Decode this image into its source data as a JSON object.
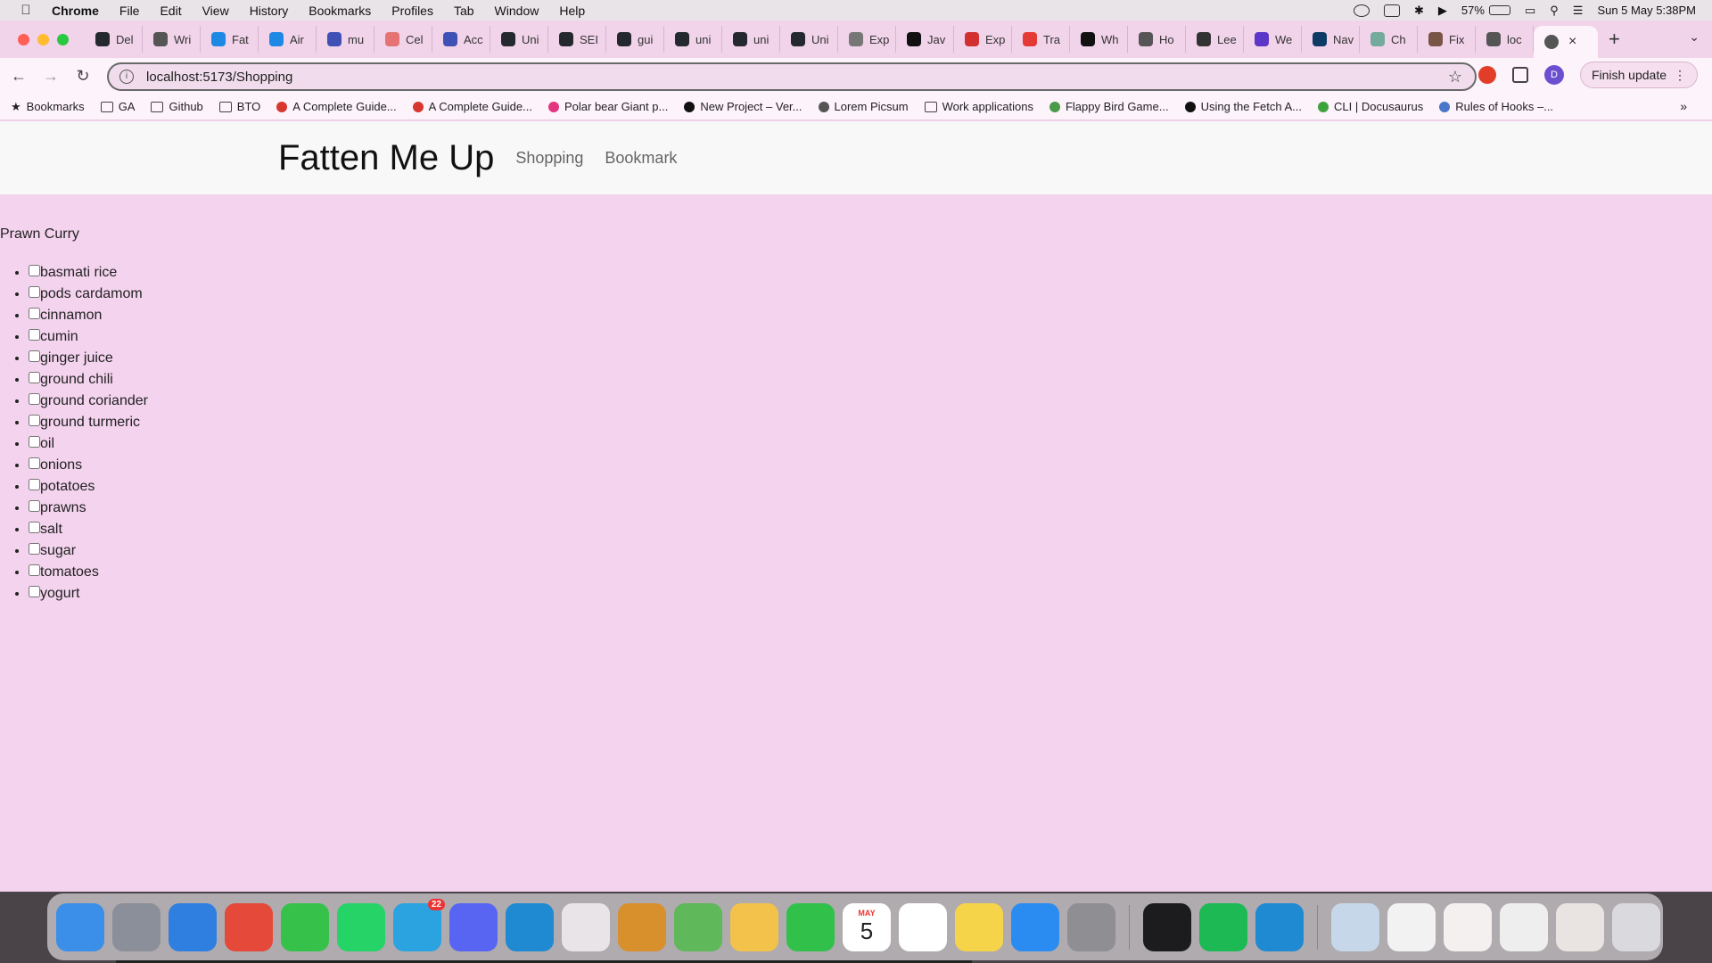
{
  "menubar": {
    "app": "Chrome",
    "items": [
      "File",
      "Edit",
      "View",
      "History",
      "Bookmarks",
      "Profiles",
      "Tab",
      "Window",
      "Help"
    ],
    "battery": "57%",
    "datetime": "Sun 5 May  5:38PM"
  },
  "tabs": [
    {
      "label": "Del",
      "color": "#24292f"
    },
    {
      "label": "Wri",
      "color": "#555555"
    },
    {
      "label": "Fat",
      "color": "#1e88e5"
    },
    {
      "label": "Air",
      "color": "#1e88e5"
    },
    {
      "label": "mu",
      "color": "#3f51b5"
    },
    {
      "label": "Cel",
      "color": "#e57373"
    },
    {
      "label": "Acc",
      "color": "#3f51b5"
    },
    {
      "label": "Uni",
      "color": "#24292f"
    },
    {
      "label": "SEI",
      "color": "#24292f"
    },
    {
      "label": "gui",
      "color": "#24292f"
    },
    {
      "label": "uni",
      "color": "#24292f"
    },
    {
      "label": "uni",
      "color": "#24292f"
    },
    {
      "label": "Uni",
      "color": "#24292f"
    },
    {
      "label": "Exp",
      "color": "#777777"
    },
    {
      "label": "Jav",
      "color": "#111111"
    },
    {
      "label": "Exp",
      "color": "#d32f2f"
    },
    {
      "label": "Tra",
      "color": "#e53935"
    },
    {
      "label": "Wh",
      "color": "#111111"
    },
    {
      "label": "Ho",
      "color": "#555555"
    },
    {
      "label": "Lee",
      "color": "#333333"
    },
    {
      "label": "We",
      "color": "#5c35c9"
    },
    {
      "label": "Nav",
      "color": "#0d3b66"
    },
    {
      "label": "Ch",
      "color": "#74aa9c"
    },
    {
      "label": "Fix",
      "color": "#795548"
    },
    {
      "label": "loc",
      "color": "#555555"
    }
  ],
  "active_tab": {
    "label": "",
    "color": "#555555"
  },
  "address": {
    "url": "localhost:5173/Shopping"
  },
  "toolbar": {
    "profile_initial": "D",
    "finish_update": "Finish update"
  },
  "bookmarks": [
    {
      "label": "Bookmarks",
      "icon": "star-icon"
    },
    {
      "label": "GA",
      "icon": "folder-icon"
    },
    {
      "label": "Github",
      "icon": "folder-icon"
    },
    {
      "label": "BTO",
      "icon": "folder-icon"
    },
    {
      "label": "A Complete Guide...",
      "icon": "asterisk-icon"
    },
    {
      "label": "A Complete Guide...",
      "icon": "asterisk-icon"
    },
    {
      "label": "Polar bear Giant p...",
      "icon": "drop-icon"
    },
    {
      "label": "New Project – Ver...",
      "icon": "vercel-icon"
    },
    {
      "label": "Lorem Picsum",
      "icon": "picture-icon"
    },
    {
      "label": "Work applications",
      "icon": "folder-icon"
    },
    {
      "label": "Flappy Bird Game...",
      "icon": "bird-icon"
    },
    {
      "label": "Using the Fetch A...",
      "icon": "mdn-icon"
    },
    {
      "label": "CLI | Docusaurus",
      "icon": "docusaurus-icon"
    },
    {
      "label": "Rules of Hooks –...",
      "icon": "react-icon"
    }
  ],
  "app": {
    "brand": "Fatten Me Up",
    "nav": [
      "Shopping",
      "Bookmark"
    ],
    "recipe_title": "Prawn Curry",
    "ingredients": [
      {
        "name": "basmati rice",
        "checked": false
      },
      {
        "name": "pods cardamom",
        "checked": false
      },
      {
        "name": "cinnamon",
        "checked": false
      },
      {
        "name": "cumin",
        "checked": false
      },
      {
        "name": "ginger juice",
        "checked": false
      },
      {
        "name": "ground chili",
        "checked": false
      },
      {
        "name": "ground coriander",
        "checked": false
      },
      {
        "name": "ground turmeric",
        "checked": false
      },
      {
        "name": "oil",
        "checked": false
      },
      {
        "name": "onions",
        "checked": false
      },
      {
        "name": "potatoes",
        "checked": false
      },
      {
        "name": "prawns",
        "checked": false
      },
      {
        "name": "salt",
        "checked": false
      },
      {
        "name": "sugar",
        "checked": false
      },
      {
        "name": "tomatoes",
        "checked": false
      },
      {
        "name": "yogurt",
        "checked": false
      }
    ]
  },
  "dock": [
    {
      "name": "finder",
      "color": "#3b8fe8"
    },
    {
      "name": "launchpad",
      "color": "#8a8f99"
    },
    {
      "name": "safari",
      "color": "#2f7fe0"
    },
    {
      "name": "chrome",
      "color": "#e5493a"
    },
    {
      "name": "messages",
      "color": "#36c24a"
    },
    {
      "name": "whatsapp",
      "color": "#25d366"
    },
    {
      "name": "telegram",
      "color": "#2aa3e0",
      "badge": "22"
    },
    {
      "name": "discord",
      "color": "#5865f2"
    },
    {
      "name": "vscode",
      "color": "#1f8ad2"
    },
    {
      "name": "slack",
      "color": "#e8e4e8"
    },
    {
      "name": "dog-app",
      "color": "#d8902c"
    },
    {
      "name": "maps",
      "color": "#5fb85a"
    },
    {
      "name": "photos",
      "color": "#f3c24a"
    },
    {
      "name": "facetime",
      "color": "#31c14b"
    },
    {
      "name": "calendar",
      "color": "#ffffff",
      "month": "MAY",
      "day": "5"
    },
    {
      "name": "reminders",
      "color": "#ffffff"
    },
    {
      "name": "notes",
      "color": "#f6d44a"
    },
    {
      "name": "app-store",
      "color": "#2a8cf0"
    },
    {
      "name": "system-settings",
      "color": "#8e8e93"
    },
    {
      "name": "terminal",
      "color": "#1c1c1e"
    },
    {
      "name": "spotify",
      "color": "#1db954"
    },
    {
      "name": "vscode-2",
      "color": "#1f8ad2"
    },
    {
      "name": "finder-window",
      "color": "#c7d7ea"
    },
    {
      "name": "window-thumb-1",
      "color": "#f2f2f2"
    },
    {
      "name": "window-thumb-2",
      "color": "#f5f0f0"
    },
    {
      "name": "window-thumb-3",
      "color": "#eeeeee"
    },
    {
      "name": "window-thumb-4",
      "color": "#e9e4e2"
    },
    {
      "name": "trash",
      "color": "#d9d9de"
    }
  ]
}
